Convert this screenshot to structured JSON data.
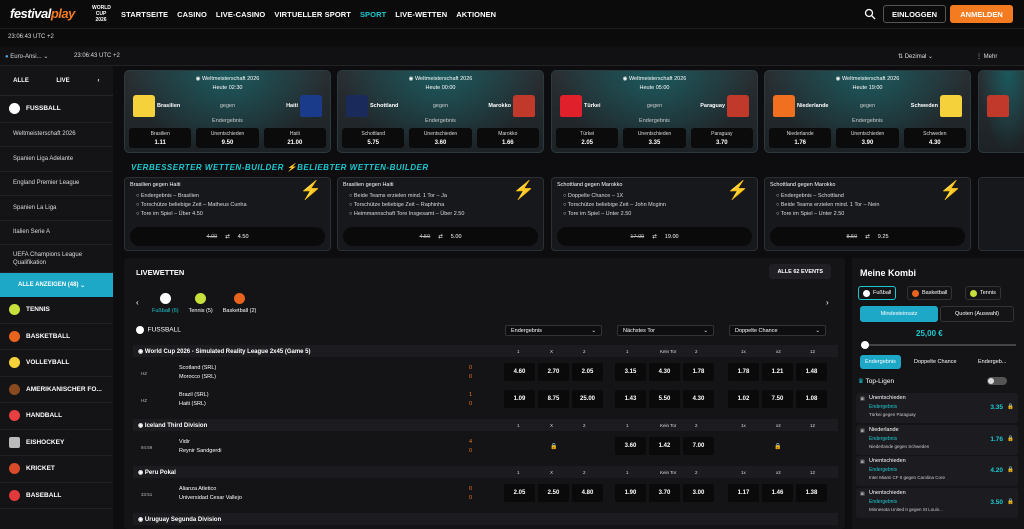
{
  "brand": {
    "logo_a": "festival",
    "logo_b": "play",
    "wc_a": "WORLD",
    "wc_b": "CUP",
    "wc_c": "2026"
  },
  "nav": [
    "STARTSEITE",
    "CASINO",
    "LIVE-CASINO",
    "VIRTUELLER SPORT",
    "SPORT",
    "LIVE-WETTEN",
    "AKTIONEN"
  ],
  "login": "EINLOGGEN",
  "register": "ANMELDEN",
  "clock": "23:06:43 UTC +2",
  "toolbar": {
    "odds_format": "Euro-Ansi...",
    "clock": "23:06:43 UTC +2",
    "decimal": "Dezimal",
    "more": "Mehr"
  },
  "sidebar": {
    "tab_all": "ALLE",
    "tab_live": "LIVE",
    "sport_main": "FUSSBALL",
    "leagues": [
      "Weltmeisterschaft 2026",
      "Spanien Liga Adelante",
      "England Premier League",
      "Spanien La Liga",
      "Italien Serie A",
      "UEFA Champions League Qualifikation"
    ],
    "show_all": "ALLE ANZEIGEN (48)",
    "sports": [
      "TENNIS",
      "BASKETBALL",
      "VOLLEYBALL",
      "AMERIKANISCHER FO...",
      "HANDBALL",
      "EISHOCKEY",
      "KRICKET",
      "BASEBALL"
    ]
  },
  "cards": [
    {
      "comp": "Weltmeisterschaft 2026",
      "date": "Heute 02:30",
      "home": "Brasilien",
      "away": "Haiti",
      "vs": "gegen",
      "market": "Endergebnis",
      "o": [
        [
          "Brasilien",
          "1.11"
        ],
        [
          "Unentschieden",
          "9.50"
        ],
        [
          "Haiti",
          "21.00"
        ]
      ]
    },
    {
      "comp": "Weltmeisterschaft 2026",
      "date": "Heute 00:00",
      "home": "Schottland",
      "away": "Marokko",
      "vs": "gegen",
      "market": "Endergebnis",
      "o": [
        [
          "Schottland",
          "5.75"
        ],
        [
          "Unentschieden",
          "3.60"
        ],
        [
          "Marokko",
          "1.66"
        ]
      ]
    },
    {
      "comp": "Weltmeisterschaft 2026",
      "date": "Heute 05:00",
      "home": "Türkei",
      "away": "Paraguay",
      "vs": "gegen",
      "market": "Endergebnis",
      "o": [
        [
          "Türkei",
          "2.05"
        ],
        [
          "Unentschieden",
          "3.35"
        ],
        [
          "Paraguay",
          "3.70"
        ]
      ]
    },
    {
      "comp": "Weltmeisterschaft 2026",
      "date": "Heute 19:00",
      "home": "Niederlande",
      "away": "Schweden",
      "vs": "gegen",
      "market": "Endergebnis",
      "o": [
        [
          "Niederlande",
          "1.76"
        ],
        [
          "Unentschieden",
          "3.90"
        ],
        [
          "Schweden",
          "4.30"
        ]
      ]
    }
  ],
  "bb_title": "VERBESSERTER WETTEN-BUILDER ⚡BELIEBTER WETTEN-BUILDER",
  "builders": [
    {
      "h": "Brasilien gegen Haiti",
      "l": [
        "Endergebnis – Brasilien",
        "Torschütze beliebige Zeit – Matheus Cunha",
        "Tore im Spiel – Über 4.50"
      ],
      "old": "4.00",
      "new": "4.50"
    },
    {
      "h": "Brasilien gegen Haiti",
      "l": [
        "Beide Teams erzielen mind. 1 Tor – Ja",
        "Torschütze beliebige Zeit – Raphinha",
        "Heimmannschaft Tore Insgesamt – Über 2.50"
      ],
      "old": "4.50",
      "new": "5.00"
    },
    {
      "h": "Schottland gegen Marokko",
      "l": [
        "Doppelte Chance – 1X",
        "Torschütze beliebige Zeit – John Mcginn",
        "Tore im Spiel – Unter 2.50"
      ],
      "old": "17.00",
      "new": "19.00"
    },
    {
      "h": "Schottland gegen Marokko",
      "l": [
        "Endergebnis – Schottland",
        "Beide Teams erzielen mind. 1 Tor – Nein",
        "Tore im Spiel – Unter 2.50"
      ],
      "old": "8.50",
      "new": "9.25"
    }
  ],
  "live": {
    "title": "LIVEWETTEN",
    "all": "ALLE 62 EVENTS",
    "tabs": [
      "Fußball (6)",
      "Tennis (5)",
      "Basketball (2)"
    ],
    "sport": "FUSSBALL",
    "selects": [
      "Endergebnis",
      "Nächstes Tor",
      "Doppelte Chance"
    ],
    "heads": [
      "1",
      "X",
      "2",
      "1",
      "Kein Tor",
      "2",
      "1x",
      "x2",
      "12"
    ],
    "groups": [
      {
        "name": "World Cup 2026 - Simulated Reality League 2x45 (Game 5)",
        "matches": [
          {
            "t": "HZ",
            "a": "Scotland (SRL)",
            "b": "Morocco (SRL)",
            "sa": "0",
            "sb": "0",
            "o": [
              "4.60",
              "2.70",
              "2.05",
              "3.15",
              "4.30",
              "1.78",
              "1.78",
              "1.21",
              "1.48"
            ]
          },
          {
            "t": "HZ",
            "a": "Brazil (SRL)",
            "b": "Haiti (SRL)",
            "sa": "1",
            "sb": "0",
            "o": [
              "1.09",
              "8.75",
              "25.00",
              "1.43",
              "5.50",
              "4.30",
              "1.02",
              "7.50",
              "1.08"
            ]
          }
        ]
      },
      {
        "name": "Iceland Third Division",
        "matches": [
          {
            "t": "94:59",
            "a": "Vidir",
            "b": "Reynir Sandgerdi",
            "sa": "4",
            "sb": "0",
            "o": [
              "",
              "",
              "",
              "3.60",
              "1.42",
              "7.00",
              "",
              "",
              ""
            ]
          }
        ]
      },
      {
        "name": "Peru Pokal",
        "matches": [
          {
            "t": "33:51",
            "a": "Alianza Atletico",
            "b": "Universidad Cesar Vallejo",
            "sa": "0",
            "sb": "0",
            "o": [
              "2.05",
              "2.50",
              "4.80",
              "1.90",
              "3.70",
              "3.00",
              "1.17",
              "1.46",
              "1.38"
            ]
          }
        ]
      },
      {
        "name": "Uruguay Segunda Division",
        "matches": []
      }
    ]
  },
  "kombi": {
    "title": "Meine Kombi",
    "sports": [
      "Fußball",
      "Basketball",
      "Tennis"
    ],
    "tabs": [
      "Mindesteinsatz",
      "Quoten (Auswahl)"
    ],
    "amount": "25,00 €",
    "mtabs": [
      "Endergebnis",
      "Doppelte Chance",
      "Endergeb..."
    ],
    "top": "Top-Ligen",
    "items": [
      {
        "a": "Unentschieden",
        "b": "Endergebnis",
        "c": "Türkei gegen Paraguay",
        "d": "3.35"
      },
      {
        "a": "Niederlande",
        "b": "Endergebnis",
        "c": "Niederlande gegen Schweden",
        "d": "1.76"
      },
      {
        "a": "Unentschieden",
        "b": "Endergebnis",
        "c": "Inter Miami CF II gegen Carolina Core",
        "d": "4.20"
      },
      {
        "a": "Unentschieden",
        "b": "Endergebnis",
        "c": "Minnesota United II gegen St Louis...",
        "d": "3.50"
      }
    ]
  }
}
